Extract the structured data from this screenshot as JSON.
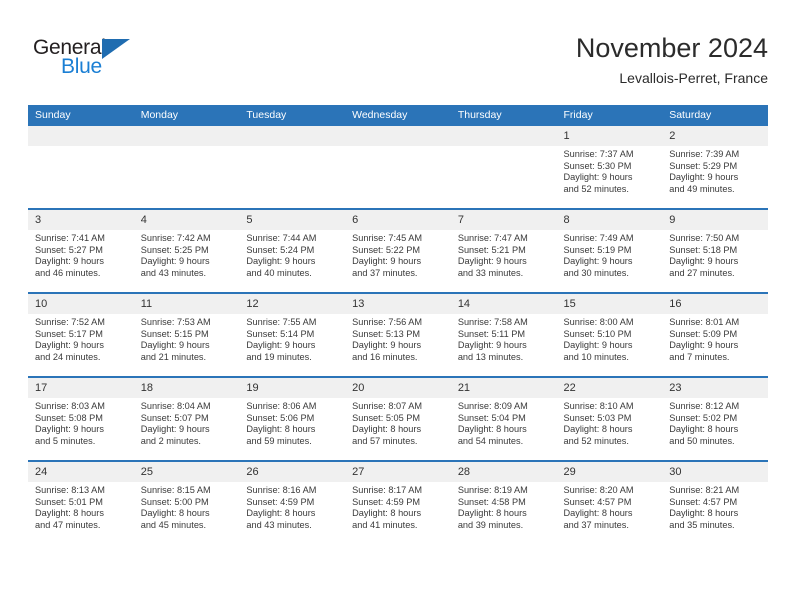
{
  "logo": {
    "word_one": "General",
    "word_two": "Blue",
    "triangle_color": "#1f6cb0",
    "word_two_color": "#1b7fd4"
  },
  "header": {
    "title": "November 2024",
    "subtitle": "Levallois-Perret, France"
  },
  "theme": {
    "header_blue": "#2b74b8",
    "daynum_band": "#f0f0f0",
    "text": "#3a3a3a"
  },
  "weekdays": [
    "Sunday",
    "Monday",
    "Tuesday",
    "Wednesday",
    "Thursday",
    "Friday",
    "Saturday"
  ],
  "labels": {
    "sunrise": "Sunrise:",
    "sunset": "Sunset:",
    "daylight": "Daylight:"
  },
  "weeks": [
    [
      {
        "day": "",
        "sunrise": "",
        "sunset": "",
        "daylight_line1": "",
        "daylight_line2": ""
      },
      {
        "day": "",
        "sunrise": "",
        "sunset": "",
        "daylight_line1": "",
        "daylight_line2": ""
      },
      {
        "day": "",
        "sunrise": "",
        "sunset": "",
        "daylight_line1": "",
        "daylight_line2": ""
      },
      {
        "day": "",
        "sunrise": "",
        "sunset": "",
        "daylight_line1": "",
        "daylight_line2": ""
      },
      {
        "day": "",
        "sunrise": "",
        "sunset": "",
        "daylight_line1": "",
        "daylight_line2": ""
      },
      {
        "day": "1",
        "sunrise": "Sunrise: 7:37 AM",
        "sunset": "Sunset: 5:30 PM",
        "daylight_line1": "Daylight: 9 hours",
        "daylight_line2": "and 52 minutes."
      },
      {
        "day": "2",
        "sunrise": "Sunrise: 7:39 AM",
        "sunset": "Sunset: 5:29 PM",
        "daylight_line1": "Daylight: 9 hours",
        "daylight_line2": "and 49 minutes."
      }
    ],
    [
      {
        "day": "3",
        "sunrise": "Sunrise: 7:41 AM",
        "sunset": "Sunset: 5:27 PM",
        "daylight_line1": "Daylight: 9 hours",
        "daylight_line2": "and 46 minutes."
      },
      {
        "day": "4",
        "sunrise": "Sunrise: 7:42 AM",
        "sunset": "Sunset: 5:25 PM",
        "daylight_line1": "Daylight: 9 hours",
        "daylight_line2": "and 43 minutes."
      },
      {
        "day": "5",
        "sunrise": "Sunrise: 7:44 AM",
        "sunset": "Sunset: 5:24 PM",
        "daylight_line1": "Daylight: 9 hours",
        "daylight_line2": "and 40 minutes."
      },
      {
        "day": "6",
        "sunrise": "Sunrise: 7:45 AM",
        "sunset": "Sunset: 5:22 PM",
        "daylight_line1": "Daylight: 9 hours",
        "daylight_line2": "and 37 minutes."
      },
      {
        "day": "7",
        "sunrise": "Sunrise: 7:47 AM",
        "sunset": "Sunset: 5:21 PM",
        "daylight_line1": "Daylight: 9 hours",
        "daylight_line2": "and 33 minutes."
      },
      {
        "day": "8",
        "sunrise": "Sunrise: 7:49 AM",
        "sunset": "Sunset: 5:19 PM",
        "daylight_line1": "Daylight: 9 hours",
        "daylight_line2": "and 30 minutes."
      },
      {
        "day": "9",
        "sunrise": "Sunrise: 7:50 AM",
        "sunset": "Sunset: 5:18 PM",
        "daylight_line1": "Daylight: 9 hours",
        "daylight_line2": "and 27 minutes."
      }
    ],
    [
      {
        "day": "10",
        "sunrise": "Sunrise: 7:52 AM",
        "sunset": "Sunset: 5:17 PM",
        "daylight_line1": "Daylight: 9 hours",
        "daylight_line2": "and 24 minutes."
      },
      {
        "day": "11",
        "sunrise": "Sunrise: 7:53 AM",
        "sunset": "Sunset: 5:15 PM",
        "daylight_line1": "Daylight: 9 hours",
        "daylight_line2": "and 21 minutes."
      },
      {
        "day": "12",
        "sunrise": "Sunrise: 7:55 AM",
        "sunset": "Sunset: 5:14 PM",
        "daylight_line1": "Daylight: 9 hours",
        "daylight_line2": "and 19 minutes."
      },
      {
        "day": "13",
        "sunrise": "Sunrise: 7:56 AM",
        "sunset": "Sunset: 5:13 PM",
        "daylight_line1": "Daylight: 9 hours",
        "daylight_line2": "and 16 minutes."
      },
      {
        "day": "14",
        "sunrise": "Sunrise: 7:58 AM",
        "sunset": "Sunset: 5:11 PM",
        "daylight_line1": "Daylight: 9 hours",
        "daylight_line2": "and 13 minutes."
      },
      {
        "day": "15",
        "sunrise": "Sunrise: 8:00 AM",
        "sunset": "Sunset: 5:10 PM",
        "daylight_line1": "Daylight: 9 hours",
        "daylight_line2": "and 10 minutes."
      },
      {
        "day": "16",
        "sunrise": "Sunrise: 8:01 AM",
        "sunset": "Sunset: 5:09 PM",
        "daylight_line1": "Daylight: 9 hours",
        "daylight_line2": "and 7 minutes."
      }
    ],
    [
      {
        "day": "17",
        "sunrise": "Sunrise: 8:03 AM",
        "sunset": "Sunset: 5:08 PM",
        "daylight_line1": "Daylight: 9 hours",
        "daylight_line2": "and 5 minutes."
      },
      {
        "day": "18",
        "sunrise": "Sunrise: 8:04 AM",
        "sunset": "Sunset: 5:07 PM",
        "daylight_line1": "Daylight: 9 hours",
        "daylight_line2": "and 2 minutes."
      },
      {
        "day": "19",
        "sunrise": "Sunrise: 8:06 AM",
        "sunset": "Sunset: 5:06 PM",
        "daylight_line1": "Daylight: 8 hours",
        "daylight_line2": "and 59 minutes."
      },
      {
        "day": "20",
        "sunrise": "Sunrise: 8:07 AM",
        "sunset": "Sunset: 5:05 PM",
        "daylight_line1": "Daylight: 8 hours",
        "daylight_line2": "and 57 minutes."
      },
      {
        "day": "21",
        "sunrise": "Sunrise: 8:09 AM",
        "sunset": "Sunset: 5:04 PM",
        "daylight_line1": "Daylight: 8 hours",
        "daylight_line2": "and 54 minutes."
      },
      {
        "day": "22",
        "sunrise": "Sunrise: 8:10 AM",
        "sunset": "Sunset: 5:03 PM",
        "daylight_line1": "Daylight: 8 hours",
        "daylight_line2": "and 52 minutes."
      },
      {
        "day": "23",
        "sunrise": "Sunrise: 8:12 AM",
        "sunset": "Sunset: 5:02 PM",
        "daylight_line1": "Daylight: 8 hours",
        "daylight_line2": "and 50 minutes."
      }
    ],
    [
      {
        "day": "24",
        "sunrise": "Sunrise: 8:13 AM",
        "sunset": "Sunset: 5:01 PM",
        "daylight_line1": "Daylight: 8 hours",
        "daylight_line2": "and 47 minutes."
      },
      {
        "day": "25",
        "sunrise": "Sunrise: 8:15 AM",
        "sunset": "Sunset: 5:00 PM",
        "daylight_line1": "Daylight: 8 hours",
        "daylight_line2": "and 45 minutes."
      },
      {
        "day": "26",
        "sunrise": "Sunrise: 8:16 AM",
        "sunset": "Sunset: 4:59 PM",
        "daylight_line1": "Daylight: 8 hours",
        "daylight_line2": "and 43 minutes."
      },
      {
        "day": "27",
        "sunrise": "Sunrise: 8:17 AM",
        "sunset": "Sunset: 4:59 PM",
        "daylight_line1": "Daylight: 8 hours",
        "daylight_line2": "and 41 minutes."
      },
      {
        "day": "28",
        "sunrise": "Sunrise: 8:19 AM",
        "sunset": "Sunset: 4:58 PM",
        "daylight_line1": "Daylight: 8 hours",
        "daylight_line2": "and 39 minutes."
      },
      {
        "day": "29",
        "sunrise": "Sunrise: 8:20 AM",
        "sunset": "Sunset: 4:57 PM",
        "daylight_line1": "Daylight: 8 hours",
        "daylight_line2": "and 37 minutes."
      },
      {
        "day": "30",
        "sunrise": "Sunrise: 8:21 AM",
        "sunset": "Sunset: 4:57 PM",
        "daylight_line1": "Daylight: 8 hours",
        "daylight_line2": "and 35 minutes."
      }
    ]
  ]
}
